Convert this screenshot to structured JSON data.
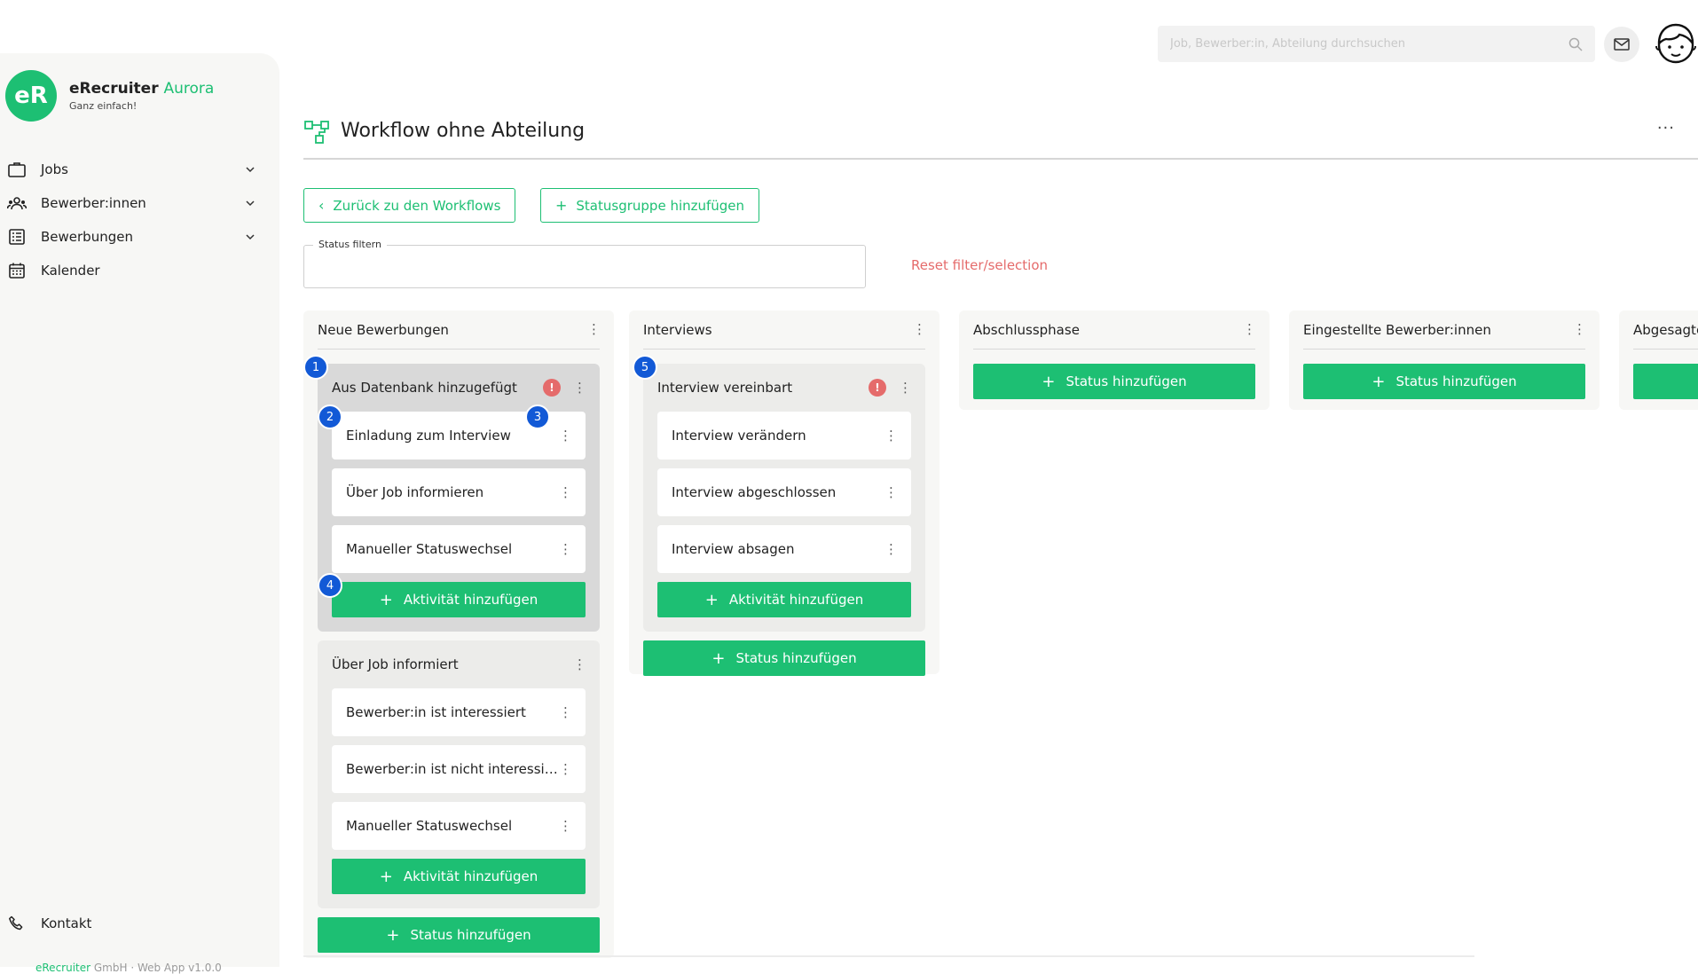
{
  "brand": {
    "short": "eR",
    "name": "eRecruiter",
    "name_accent": "Aurora",
    "tagline": "Ganz einfach!"
  },
  "nav": [
    {
      "label": "Jobs",
      "icon": "briefcase-icon",
      "expandable": true
    },
    {
      "label": "Bewerber:innen",
      "icon": "people-icon",
      "expandable": true
    },
    {
      "label": "Bewerbungen",
      "icon": "list-icon",
      "expandable": true
    },
    {
      "label": "Kalender",
      "icon": "calendar-icon",
      "expandable": false
    }
  ],
  "kontakt": "Kontakt",
  "footer": {
    "company": "eRecruiter",
    "rest": " GmbH · Web App v1.0.0"
  },
  "search": {
    "placeholder": "Job, Bewerber:in, Abteilung durchsuchen"
  },
  "page": {
    "title": "Workflow ohne Abteilung"
  },
  "actions": {
    "back": "Zurück zu den Workflows",
    "add_group": "Statusgruppe hinzufügen",
    "reset": "Reset filter/selection"
  },
  "filter": {
    "label": "Status filtern"
  },
  "labels": {
    "add_status": "Status hinzufügen",
    "add_activity": "Aktivität hinzufügen"
  },
  "badges": [
    "1",
    "2",
    "3",
    "4",
    "5"
  ],
  "columns": [
    {
      "title": "Neue Bewerbungen",
      "groups": [
        {
          "title": "Aus Datenbank hinzugefügt",
          "warning": "!",
          "activities": [
            "Einladung zum Interview",
            "Über Job informieren",
            "Manueller Statuswechsel"
          ]
        },
        {
          "title": "Über Job informiert",
          "warning": "",
          "activities": [
            "Bewerber:in ist interessiert",
            "Bewerber:in ist nicht interessiert",
            "Manueller Statuswechsel"
          ]
        }
      ]
    },
    {
      "title": "Interviews",
      "groups": [
        {
          "title": "Interview vereinbart",
          "warning": "!",
          "activities": [
            "Interview verändern",
            "Interview abgeschlossen",
            "Interview absagen"
          ]
        }
      ]
    },
    {
      "title": "Abschlussphase",
      "groups": []
    },
    {
      "title": "Eingestellte Bewerber:innen",
      "groups": []
    },
    {
      "title": "Abgesagte",
      "groups": []
    }
  ],
  "colors": {
    "accent": "#1dbf73",
    "warning": "#e56b6b",
    "badge": "#1259d6"
  }
}
